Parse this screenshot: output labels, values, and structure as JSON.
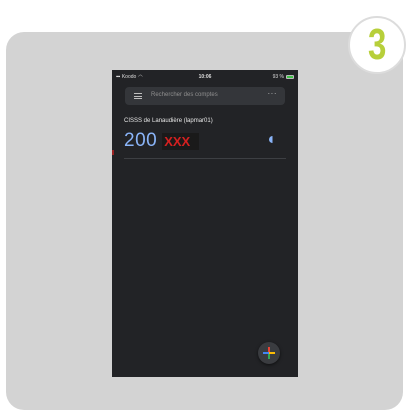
{
  "step": {
    "number": "3"
  },
  "statusbar": {
    "carrier": "Koodo",
    "time": "10:06",
    "battery_text": "93 %",
    "battery_level": 0.93
  },
  "search": {
    "placeholder": "Rechercher des comptes"
  },
  "account": {
    "name": "CISSS de Lanaudière (lapmar01)",
    "code_visible": "200",
    "code_masked": "XXX"
  },
  "colors": {
    "badge_number": "#b7cf3a",
    "code": "#8ab4f8",
    "mask_text": "#d52020",
    "phone_bg": "#222326"
  },
  "icons": {
    "menu": "menu-icon",
    "more": "more-icon",
    "timer": "timer-icon",
    "fab": "add-icon"
  }
}
